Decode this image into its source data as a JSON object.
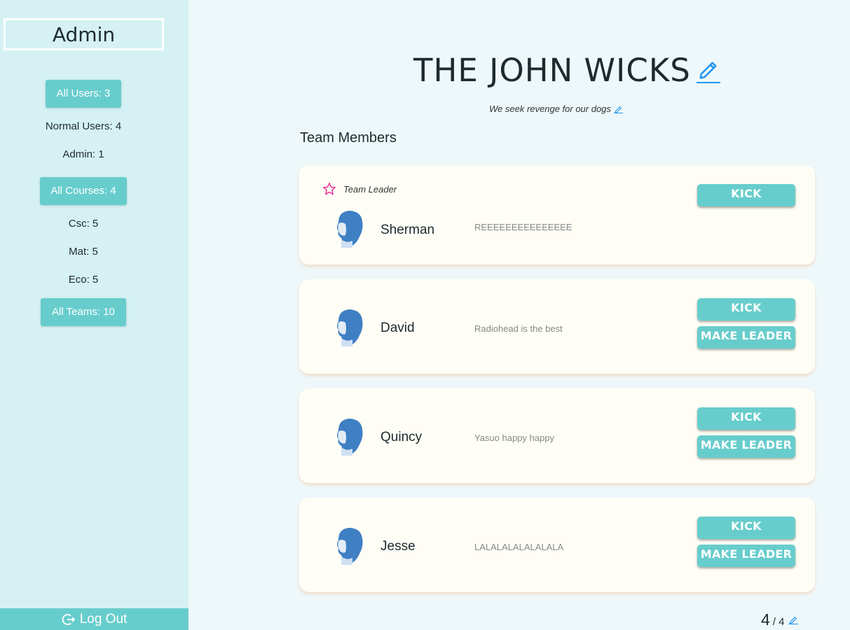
{
  "sidebar": {
    "title": "Admin",
    "items": [
      {
        "label": "All Users: 3",
        "kind": "button"
      },
      {
        "label": "Normal Users: 4",
        "kind": "text"
      },
      {
        "label": "Admin: 1",
        "kind": "text"
      },
      {
        "label": "All Courses: 4",
        "kind": "button"
      },
      {
        "label": "Csc: 5",
        "kind": "text"
      },
      {
        "label": "Mat: 5",
        "kind": "text"
      },
      {
        "label": "Eco: 5",
        "kind": "text"
      },
      {
        "label": "All Teams: 10",
        "kind": "button"
      }
    ],
    "logout_label": "Log Out",
    "logout_icon": "logout-icon"
  },
  "team": {
    "name": "THE JOHN WICKS",
    "motto": "We seek revenge for our dogs",
    "edit_icon": "pencil-icon"
  },
  "members_section_title": "Team Members",
  "leader_label": "Team Leader",
  "members": [
    {
      "name": "Sherman",
      "bio": "REEEEEEEEEEEEEEE",
      "is_leader": true,
      "kick_label": "KICK"
    },
    {
      "name": "David",
      "bio": "Radiohead is the best",
      "is_leader": false,
      "kick_label": "KICK",
      "make_leader_label": "MAKE LEADER"
    },
    {
      "name": "Quincy",
      "bio": "Yasuo happy happy",
      "is_leader": false,
      "kick_label": "KICK",
      "make_leader_label": "MAKE LEADER"
    },
    {
      "name": "Jesse",
      "bio": "LALALALALALALALA",
      "is_leader": false,
      "kick_label": "KICK",
      "make_leader_label": "MAKE LEADER"
    }
  ],
  "pager": {
    "current": "4",
    "total": "/ 4"
  },
  "colors": {
    "sidebar_bg": "#d5f1f4",
    "accent": "#67cdcc",
    "card_bg": "#fffef6",
    "page_bg": "#eef8fa",
    "edit_icon": "#2196f3",
    "leader_star": "#e91e8c"
  }
}
